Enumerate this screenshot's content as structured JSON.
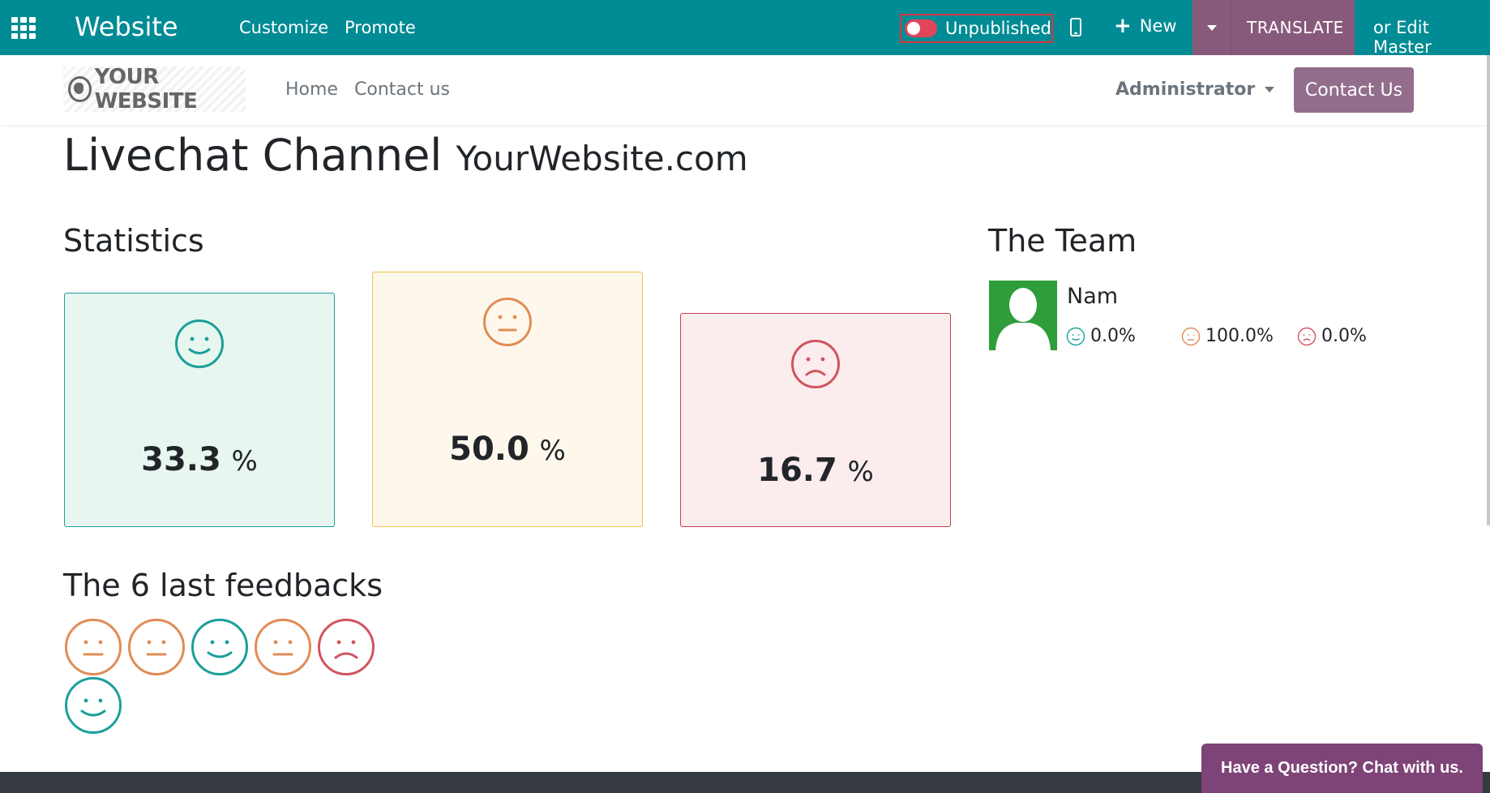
{
  "topbar": {
    "app_title": "Website",
    "nav": [
      "Customize",
      "Promote"
    ],
    "publish_label": "Unpublished",
    "new_label": "New",
    "translate_label": "TRANSLATE",
    "edit_master_label": "or Edit Master",
    "bg_color": "#018b94",
    "accent_color": "#875a7b"
  },
  "sitenav": {
    "logo_text": "YOUR WEBSITE",
    "links": [
      "Home",
      "Contact us"
    ],
    "user": "Administrator",
    "contact_button": "Contact Us"
  },
  "page": {
    "title": "Livechat Channel",
    "subtitle": "YourWebsite.com"
  },
  "statistics": {
    "heading": "Statistics",
    "cards": [
      {
        "mood": "happy",
        "value": "33.3",
        "unit": "%",
        "color": "#1a9f9a"
      },
      {
        "mood": "neutral",
        "value": "50.0",
        "unit": "%",
        "color": "#e08c55"
      },
      {
        "mood": "sad",
        "value": "16.7",
        "unit": "%",
        "color": "#d0545f"
      }
    ]
  },
  "team": {
    "heading": "The Team",
    "members": [
      {
        "name": "Nam",
        "happy": "0.0%",
        "neutral": "100.0%",
        "sad": "0.0%"
      }
    ]
  },
  "feedbacks": {
    "heading": "The 6 last feedbacks",
    "items": [
      "neutral",
      "neutral",
      "happy",
      "neutral",
      "sad",
      "happy"
    ]
  },
  "chat": {
    "button_label": "Have a Question? Chat with us."
  }
}
